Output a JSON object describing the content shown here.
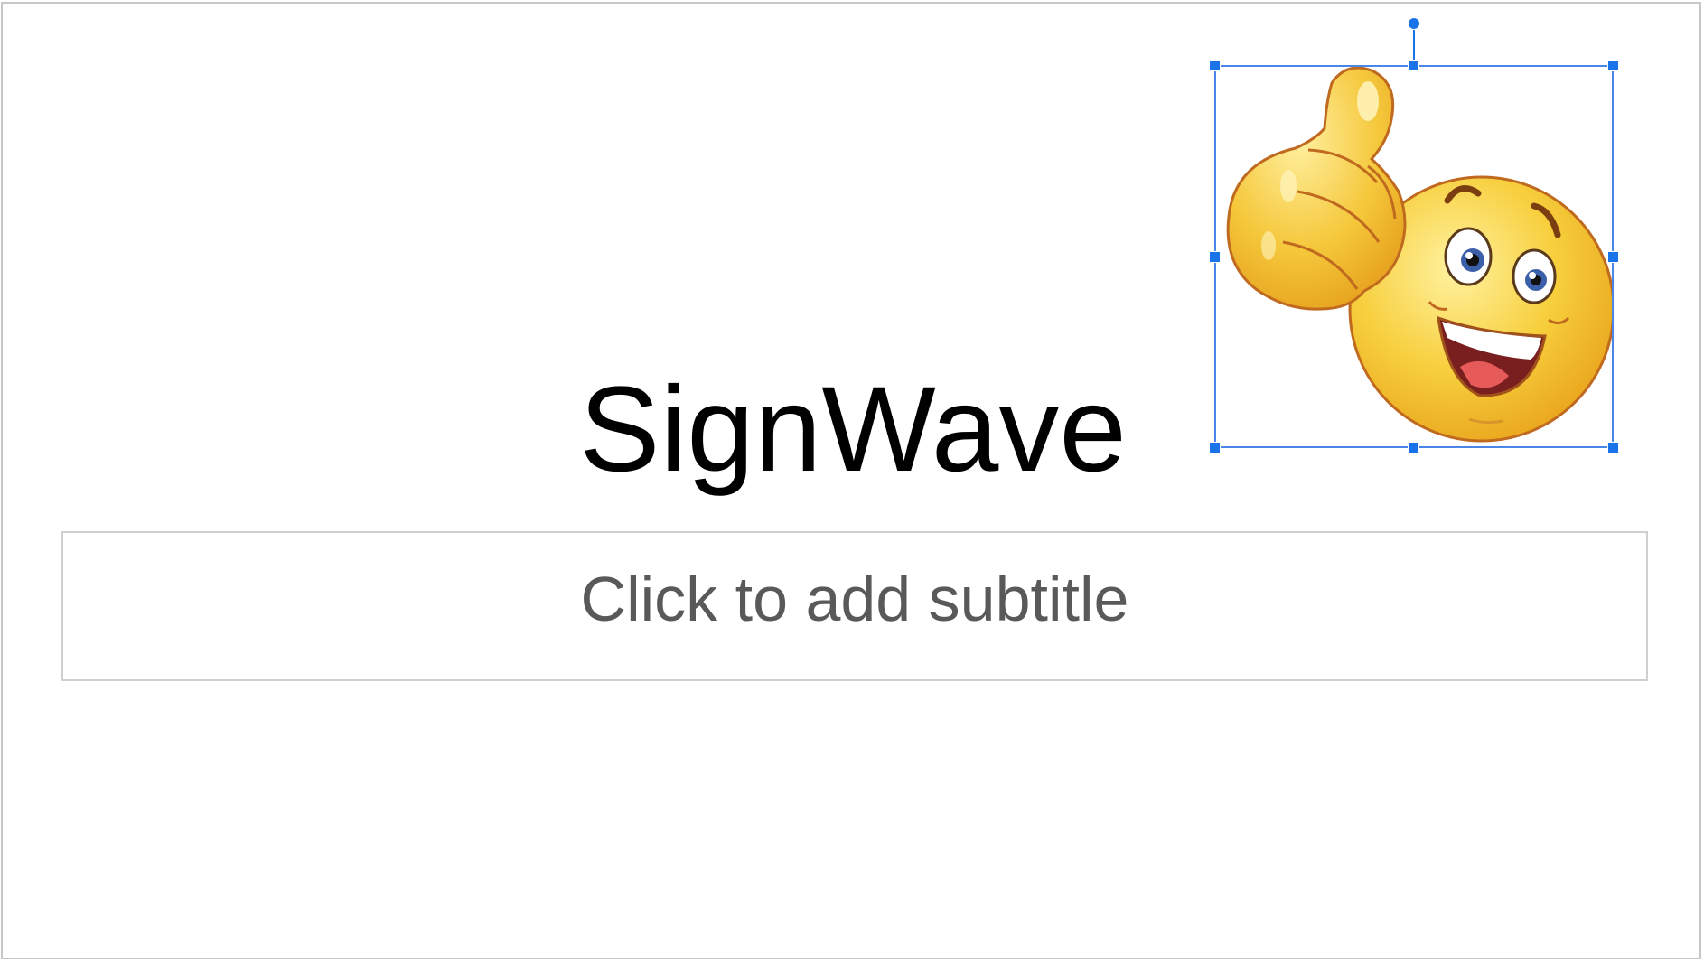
{
  "slide": {
    "title": "SignWave",
    "subtitle_placeholder": "Click to add subtitle",
    "image": {
      "icon": "thumbs-up-smiley-emoji",
      "selected": true
    }
  },
  "colors": {
    "selection": "#1a73e8",
    "title_text": "#000000",
    "placeholder_text": "#595959",
    "emoji_yellow": "#f5c842",
    "emoji_outline": "#c06a1f"
  }
}
